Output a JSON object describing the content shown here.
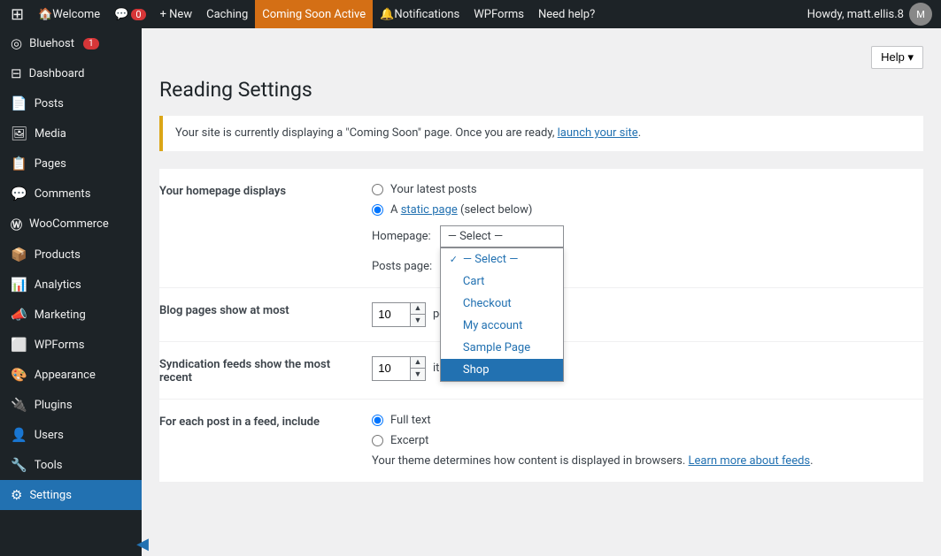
{
  "adminbar": {
    "logo": "🎭",
    "items": [
      {
        "id": "wp-logo",
        "label": "",
        "icon": "⊞",
        "type": "logo"
      },
      {
        "id": "howdy-welcome",
        "label": "Welcome",
        "icon": "🏠"
      },
      {
        "id": "comments",
        "label": "",
        "icon": "💬",
        "count": "0"
      },
      {
        "id": "new",
        "label": "+ New",
        "icon": ""
      },
      {
        "id": "caching",
        "label": "Caching",
        "icon": ""
      },
      {
        "id": "coming-soon",
        "label": "Coming Soon Active",
        "icon": "",
        "active": true
      },
      {
        "id": "notifications",
        "label": "Notifications",
        "icon": "🔔"
      },
      {
        "id": "wpforms",
        "label": "WPForms",
        "icon": ""
      },
      {
        "id": "help",
        "label": "Need help?",
        "icon": ""
      }
    ],
    "right": {
      "user": "Howdy, matt.ellis.8",
      "avatar_text": "M"
    }
  },
  "sidebar": {
    "items": [
      {
        "id": "bluehost",
        "label": "Bluehost",
        "icon": "◎",
        "badge": "1"
      },
      {
        "id": "dashboard",
        "label": "Dashboard",
        "icon": "⊟"
      },
      {
        "id": "posts",
        "label": "Posts",
        "icon": "📄"
      },
      {
        "id": "media",
        "label": "Media",
        "icon": "🖼"
      },
      {
        "id": "pages",
        "label": "Pages",
        "icon": "📋"
      },
      {
        "id": "comments",
        "label": "Comments",
        "icon": "💬"
      },
      {
        "id": "woocommerce",
        "label": "WooCommerce",
        "icon": "Ⓦ"
      },
      {
        "id": "products",
        "label": "Products",
        "icon": "📦"
      },
      {
        "id": "analytics",
        "label": "Analytics",
        "icon": "📊"
      },
      {
        "id": "marketing",
        "label": "Marketing",
        "icon": "📣"
      },
      {
        "id": "wpforms",
        "label": "WPForms",
        "icon": "⬜"
      },
      {
        "id": "appearance",
        "label": "Appearance",
        "icon": "🎨"
      },
      {
        "id": "plugins",
        "label": "Plugins",
        "icon": "🔌"
      },
      {
        "id": "users",
        "label": "Users",
        "icon": "👤"
      },
      {
        "id": "tools",
        "label": "Tools",
        "icon": "🔧"
      },
      {
        "id": "settings",
        "label": "Settings",
        "icon": "⚙"
      }
    ]
  },
  "page": {
    "title": "Reading Settings",
    "help_button": "Help ▾",
    "notice": {
      "text": "Your site is currently displaying a \"Coming Soon\" page. Once you are ready,",
      "link_text": "launch your site",
      "text_after": "."
    }
  },
  "settings": {
    "homepage_displays": {
      "label": "Your homepage displays",
      "option1_label": "Your latest posts",
      "option2_label": "A",
      "option2_link": "static page",
      "option2_rest": "(select below)"
    },
    "homepage_select": {
      "label": "Homepage:",
      "current": "— Select —",
      "options": [
        {
          "value": "select",
          "label": "— Select —",
          "checked": true
        },
        {
          "value": "cart",
          "label": "Cart"
        },
        {
          "value": "checkout",
          "label": "Checkout"
        },
        {
          "value": "my-account",
          "label": "My account"
        },
        {
          "value": "sample-page",
          "label": "Sample Page"
        },
        {
          "value": "shop",
          "label": "Shop",
          "selected": true
        }
      ]
    },
    "posts_page_select": {
      "label": "Posts page:"
    },
    "blog_pages": {
      "label": "Blog pages show at most",
      "value": "10",
      "unit": "posts"
    },
    "syndication_feeds": {
      "label": "Syndication feeds show the most recent",
      "value": "10",
      "unit": "items"
    },
    "feed_include": {
      "label": "For each post in a feed, include",
      "option1": "Full text",
      "option2": "Excerpt",
      "note": "Your theme determines how content is displayed in browsers.",
      "link_text": "Learn more about feeds",
      "link_after": "."
    }
  }
}
